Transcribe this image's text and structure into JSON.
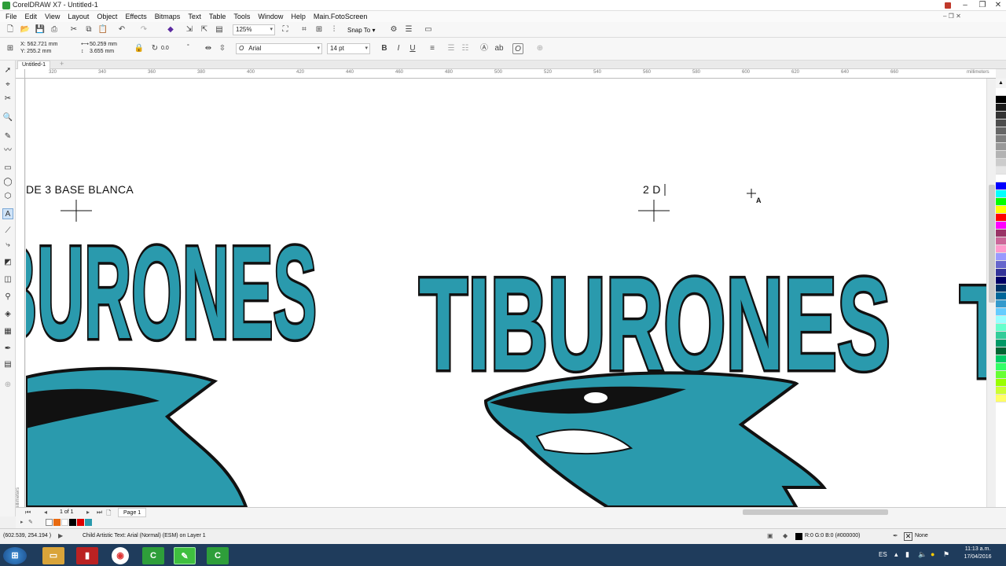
{
  "window": {
    "title": "CorelDRAW X7 - Untitled-1"
  },
  "menu": [
    "File",
    "Edit",
    "View",
    "Layout",
    "Object",
    "Effects",
    "Bitmaps",
    "Text",
    "Table",
    "Tools",
    "Window",
    "Help",
    "Main.FotoScreen"
  ],
  "toolbar": {
    "zoom": "125%",
    "snap_to": "Snap To"
  },
  "property_bar": {
    "x": "X: 562.721 mm",
    "y": "Y: 255.2 mm",
    "width": "50.259 mm",
    "height": "3.655 mm",
    "rotation": "0.0",
    "degree": "°",
    "font": "Arial",
    "font_size": "14 pt"
  },
  "document_tab": "Untitled-1",
  "ruler": {
    "h_ticks": [
      "320",
      "340",
      "360",
      "380",
      "400",
      "420",
      "440",
      "460",
      "480",
      "500",
      "520",
      "540",
      "560",
      "580",
      "600",
      "620",
      "640",
      "660"
    ],
    "unit": "millimeters"
  },
  "canvas": {
    "label_left": "DE 3 BASE BLANCA",
    "label_right": "2 D",
    "logo_text": "TIBURONES"
  },
  "page_nav": {
    "position": "1 of 1",
    "page": "Page 1"
  },
  "status": {
    "coords": "(602.539, 254.194 )",
    "object_info": "Child Artistic Text: Arial (Normal) (ESM) on Layer 1",
    "fill": "R:0 G:0 B:0 (#000000)",
    "outline": "None"
  },
  "taskbar": {
    "lang": "ES",
    "time": "11:13 a.m.",
    "date": "17/04/2016"
  },
  "colors": {
    "teal": "#2a9aad",
    "dark": "#111111",
    "light_teal": "#d8f0f4",
    "taskbar": "#1f3c5c"
  },
  "palette": [
    "#ffffff",
    "#000000",
    "#1a1a1a",
    "#333333",
    "#4d4d4d",
    "#666666",
    "#808080",
    "#999999",
    "#b3b3b3",
    "#cccccc",
    "#e6e6e6",
    "#ffffff",
    "#0000ff",
    "#00ffff",
    "#00ff00",
    "#ffff00",
    "#ff0000",
    "#ff00ff",
    "#993366",
    "#cc6699",
    "#ff99cc",
    "#9999ff",
    "#6666cc",
    "#333399",
    "#000066",
    "#003366",
    "#006699",
    "#3399cc",
    "#66ccff",
    "#99ffff",
    "#66ffcc",
    "#33cc99",
    "#009966",
    "#006633",
    "#00cc66",
    "#33ff66",
    "#66ff33",
    "#99ff00",
    "#ccff33",
    "#ffff66"
  ]
}
